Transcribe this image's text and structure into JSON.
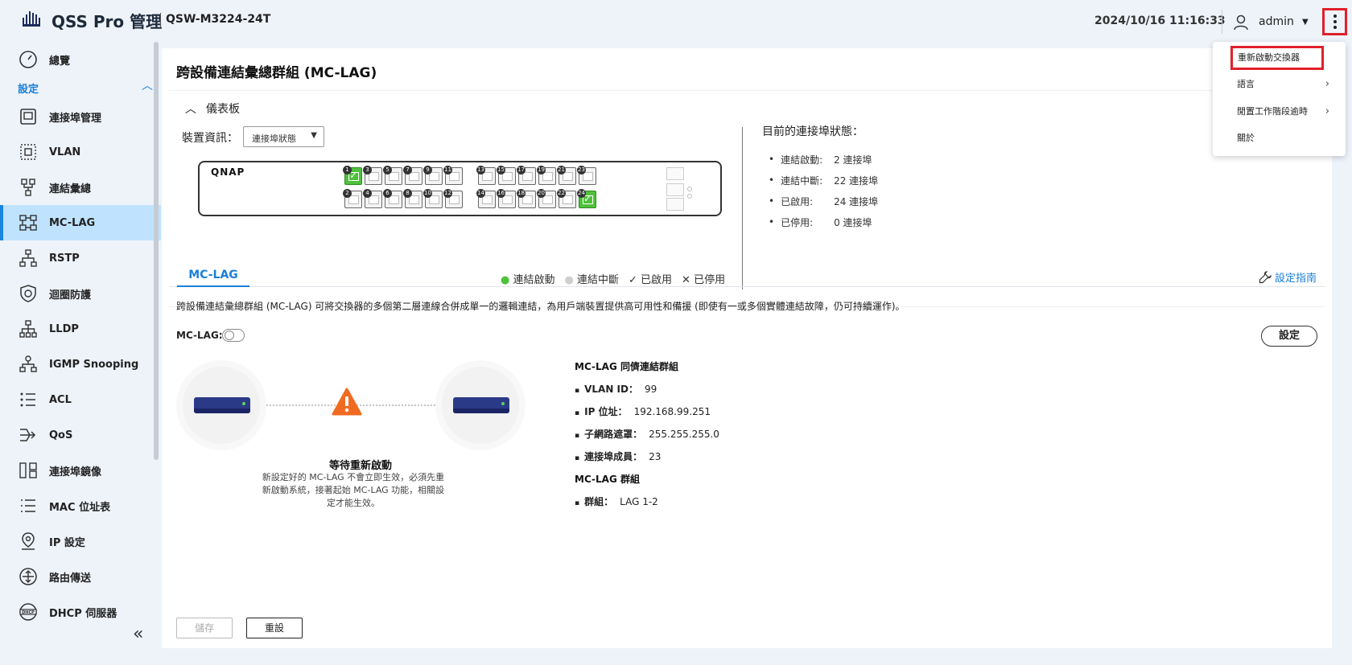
{
  "header": {
    "app_title": "QSS Pro 管理",
    "model": "QSW-M3224-24T",
    "datetime": "2024/10/16 11:16:33",
    "username": "admin"
  },
  "sidebar": {
    "overview": "總覽",
    "section": "設定",
    "items": [
      {
        "label": "連接埠管理",
        "icon": "port-icon"
      },
      {
        "label": "VLAN",
        "icon": "vlan-icon"
      },
      {
        "label": "連結彙總",
        "icon": "link-aggregation-icon"
      },
      {
        "label": "MC-LAG",
        "icon": "mclag-icon",
        "active": true
      },
      {
        "label": "RSTP",
        "icon": "rstp-icon"
      },
      {
        "label": "迴圈防護",
        "icon": "loop-protection-icon"
      },
      {
        "label": "LLDP",
        "icon": "lldp-icon"
      },
      {
        "label": "IGMP Snooping",
        "icon": "igmp-icon"
      },
      {
        "label": "ACL",
        "icon": "acl-icon"
      },
      {
        "label": "QoS",
        "icon": "qos-icon"
      },
      {
        "label": "連接埠鏡像",
        "icon": "port-mirror-icon"
      },
      {
        "label": "MAC 位址表",
        "icon": "mac-table-icon"
      },
      {
        "label": "IP 設定",
        "icon": "ip-settings-icon"
      },
      {
        "label": "路由傳送",
        "icon": "routing-icon"
      },
      {
        "label": "DHCP 伺服器",
        "icon": "dhcp-icon"
      }
    ]
  },
  "page": {
    "title": "跨設備連結彙總群組 (MC-LAG)",
    "dashboard": {
      "toggle_label": "儀表板",
      "device_info_label": "裝置資訊：",
      "device_select_value": "連接埠狀態",
      "brand": "QNAP",
      "ports_up": [
        1,
        24
      ],
      "legend": {
        "up": "連結啟動",
        "down": "連結中斷",
        "enabled": "已啟用",
        "disabled": "已停用"
      },
      "status_title": "目前的連接埠狀態：",
      "status": [
        {
          "key": "連結啟動:",
          "value": "2 連接埠"
        },
        {
          "key": "連結中斷:",
          "value": "22 連接埠"
        },
        {
          "key": "已啟用:",
          "value": "24 連接埠"
        },
        {
          "key": "已停用:",
          "value": "0 連接埠"
        }
      ]
    },
    "tab": "MC-LAG",
    "guide_link": "設定指南",
    "description": "跨設備連結彙總群組 (MC-LAG) 可將交換器的多個第二層連線合併成單一的邏輯連結，為用戶端裝置提供高可用性和備援 (即使有一或多個實體連結故障，仍可持續運作)。",
    "mclag_label": "MC-LAG:",
    "mclag_enabled": false,
    "settings_button": "設定",
    "wait": {
      "title": "等待重新啟動",
      "desc": "新設定好的 MC-LAG 不會立即生效，必須先重新啟動系統，接著起始 MC-LAG 功能，相關設定才能生效。"
    },
    "peer": {
      "heading": "MC-LAG 同儕連結群組",
      "rows": [
        {
          "key": "VLAN ID：",
          "value": "99"
        },
        {
          "key": "IP 位址：",
          "value": "192.168.99.251"
        },
        {
          "key": "子網路遮罩：",
          "value": "255.255.255.0"
        },
        {
          "key": "連接埠成員：",
          "value": "23"
        }
      ],
      "group_heading": "MC-LAG 群組",
      "group_key": "群組：",
      "group_value": "LAG 1-2"
    },
    "save_button": "儲存",
    "reset_button": "重設"
  },
  "menu": {
    "items": [
      "重新啟動交換器",
      "語言",
      "閒置工作階段逾時",
      "關於"
    ]
  },
  "colors": {
    "accent": "#1a7fd8",
    "highlight": "#e0202a",
    "port_up": "#4fc13c",
    "warning": "#f06a22"
  }
}
